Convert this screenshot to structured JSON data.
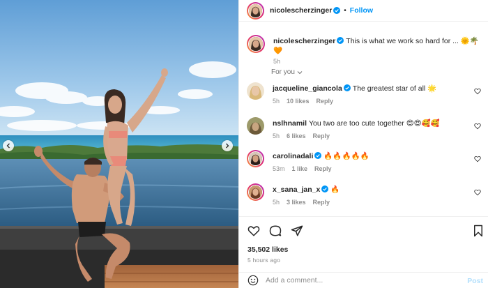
{
  "post": {
    "author": "nicolescherzinger",
    "follow_label": "Follow",
    "header_separator": "•",
    "caption": "This is what we work so hard for ... 🌞🌴🧡",
    "caption_time": "5h"
  },
  "comments_filter": {
    "label": "For you"
  },
  "comments": [
    {
      "user": "jacqueline_giancola",
      "verified": true,
      "text": "The greatest star of all 🌟",
      "time": "5h",
      "likes": "10 likes",
      "reply": "Reply",
      "avatar_color": "#d9c4a8"
    },
    {
      "user": "nslhnamil",
      "verified": false,
      "text": "You two are too cute together 😍😍🥰🥰",
      "time": "5h",
      "likes": "6 likes",
      "reply": "Reply",
      "avatar_color": "#8a7a5a"
    },
    {
      "user": "carolinadali",
      "verified": true,
      "text": "🔥🔥🔥🔥🔥",
      "time": "53m",
      "likes": "1 like",
      "reply": "Reply",
      "avatar_color": "#3a2a22"
    },
    {
      "user": "x_sana_jan_x",
      "verified": true,
      "text": "🔥",
      "time": "5h",
      "likes": "3 likes",
      "reply": "Reply",
      "avatar_color": "#a0603a"
    }
  ],
  "engagement": {
    "likes": "35,502 likes",
    "time_ago": "5 hours ago"
  },
  "comment_box": {
    "placeholder": "Add a comment...",
    "post_label": "Post"
  },
  "icons": [
    "chevron-left-icon",
    "chevron-right-icon",
    "verified-badge-icon",
    "heart-icon",
    "comment-icon",
    "share-icon",
    "bookmark-icon",
    "smiley-icon",
    "chevron-down-icon"
  ],
  "colors": {
    "accent": "#0095f6",
    "verified": "#0095f6",
    "muted": "#8e8e8e",
    "post_disabled": "#b2dffc"
  }
}
